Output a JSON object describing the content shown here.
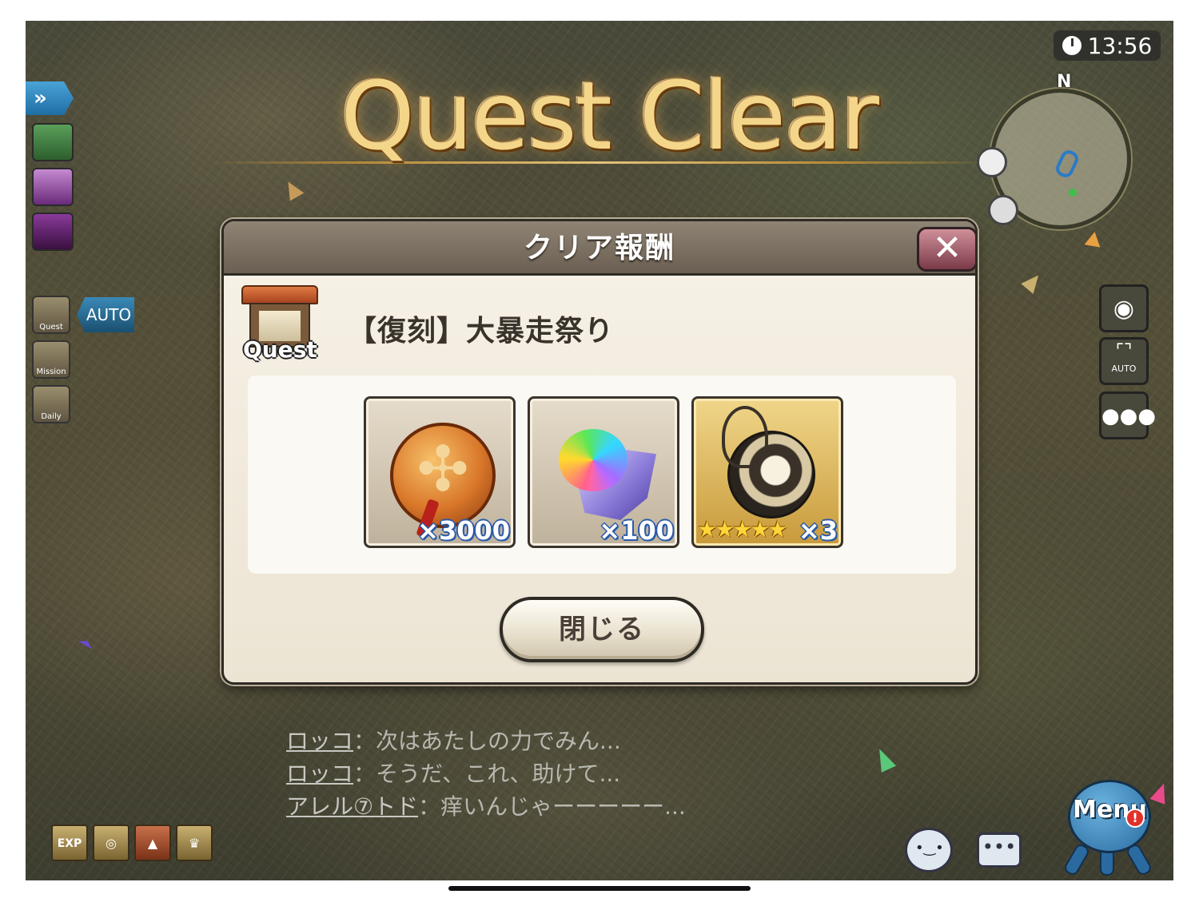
{
  "hud": {
    "clock": "13:56",
    "compass_north": "N",
    "fast_forward_label": "»",
    "auto_label": "AUTO",
    "quest_label": "Quest",
    "mission_label": "Mission",
    "daily_label": "Daily",
    "auto_camera_label": "AUTO"
  },
  "banner": {
    "title": "Quest Clear"
  },
  "dialog": {
    "title": "クリア報酬",
    "close_symbol": "✕",
    "quest_icon_label": "Quest",
    "quest_name": "【復刻】大暴走祭り",
    "rewards": [
      {
        "icon": "medallion-coin-icon",
        "count": "×3000",
        "stars": ""
      },
      {
        "icon": "rainbow-crystal-icon",
        "count": "×100",
        "stars": ""
      },
      {
        "icon": "gold-pouch-icon",
        "count": "×3",
        "stars": "★★★★★"
      }
    ],
    "close_button": "閉じる"
  },
  "chat": {
    "lines": [
      {
        "speaker": "ロッコ",
        "separator": "：",
        "text": "次はあたしの力でみん..."
      },
      {
        "speaker": "ロッコ",
        "separator": "：",
        "text": "そうだ、これ、助けて..."
      },
      {
        "speaker": "アレル⑦トド",
        "separator": "：",
        "text": "痒いんじゃーーーーー..."
      }
    ]
  },
  "bottom_bar": {
    "exp_label": "EXP",
    "menu_label": "Menu",
    "menu_badge": "!",
    "message_dots": "•••"
  },
  "colors": {
    "title_gold": "#f4d68a",
    "dialog_header": "#7a6f62",
    "close_x": "#a85a68",
    "reward_count_outline": "#2a5aa8"
  }
}
